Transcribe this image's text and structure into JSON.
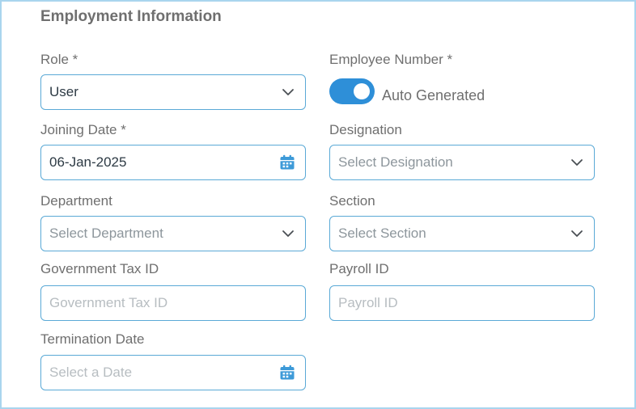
{
  "section": {
    "title": "Employment Information"
  },
  "fields": {
    "role": {
      "label": "Role *",
      "value": "User"
    },
    "employee_number": {
      "label": "Employee Number *",
      "toggle_label": "Auto Generated",
      "toggle_on": true
    },
    "joining_date": {
      "label": "Joining Date *",
      "value": "06-Jan-2025"
    },
    "designation": {
      "label": "Designation",
      "placeholder": "Select Designation"
    },
    "department": {
      "label": "Department",
      "placeholder": "Select Department"
    },
    "section": {
      "label": "Section",
      "placeholder": "Select Section"
    },
    "government_tax_id": {
      "label": "Government Tax ID",
      "placeholder": "Government Tax ID"
    },
    "payroll_id": {
      "label": "Payroll ID",
      "placeholder": "Payroll ID"
    },
    "termination_date": {
      "label": "Termination Date",
      "placeholder": "Select a Date"
    }
  },
  "icons": {
    "dropdown": "chevron-down-icon",
    "calendar": "calendar-icon"
  },
  "colors": {
    "accent": "#2e8fd8",
    "border": "#5aa9d6",
    "label": "#6f6f6f",
    "frame": "#a9d5ee"
  }
}
